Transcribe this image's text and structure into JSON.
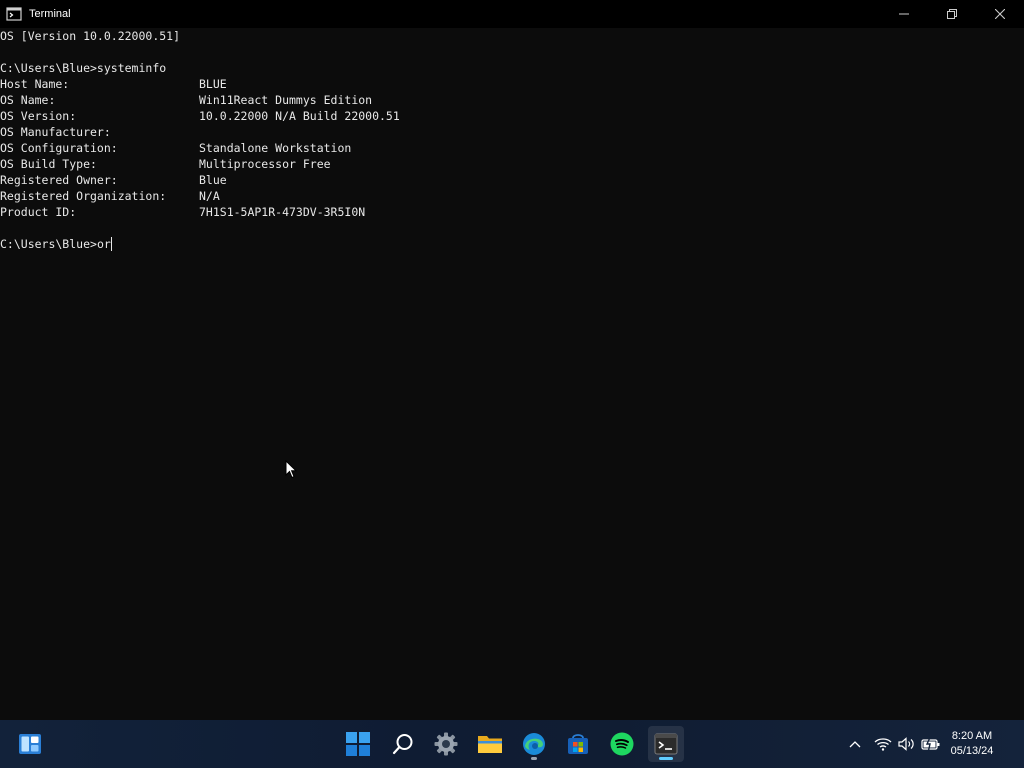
{
  "window": {
    "title": "Terminal"
  },
  "terminal": {
    "version_line": "OS [Version 10.0.22000.51]",
    "command_line": "C:\\Users\\Blue>systeminfo",
    "info": [
      {
        "key": "Host Name:",
        "value": "BLUE"
      },
      {
        "key": "OS Name:",
        "value": "Win11React Dummys Edition"
      },
      {
        "key": "OS Version:",
        "value": "10.0.22000 N/A Build 22000.51"
      },
      {
        "key": "OS Manufacturer:",
        "value": ""
      },
      {
        "key": "OS Configuration:",
        "value": "Standalone Workstation"
      },
      {
        "key": "OS Build Type:",
        "value": "Multiprocessor Free"
      },
      {
        "key": "Registered Owner:",
        "value": "Blue"
      },
      {
        "key": "Registered Organization:",
        "value": "N/A"
      },
      {
        "key": "Product ID:",
        "value": "7H1S1-5AP1R-473DV-3R5I0N"
      }
    ],
    "prompt": "C:\\Users\\Blue>",
    "input": "or"
  },
  "taskbar": {
    "icons": [
      "widgets-icon",
      "start-icon",
      "search-icon",
      "settings-icon",
      "file-explorer-icon",
      "edge-icon",
      "store-icon",
      "spotify-icon",
      "terminal-icon"
    ],
    "clock_time": "8:20 AM",
    "clock_date": "05/13/24"
  },
  "colors": {
    "terminal_bg": "#0c0c0c",
    "text": "#e8e8e8",
    "taskbar_bg": "#12223a",
    "accent": "#60cdff"
  }
}
